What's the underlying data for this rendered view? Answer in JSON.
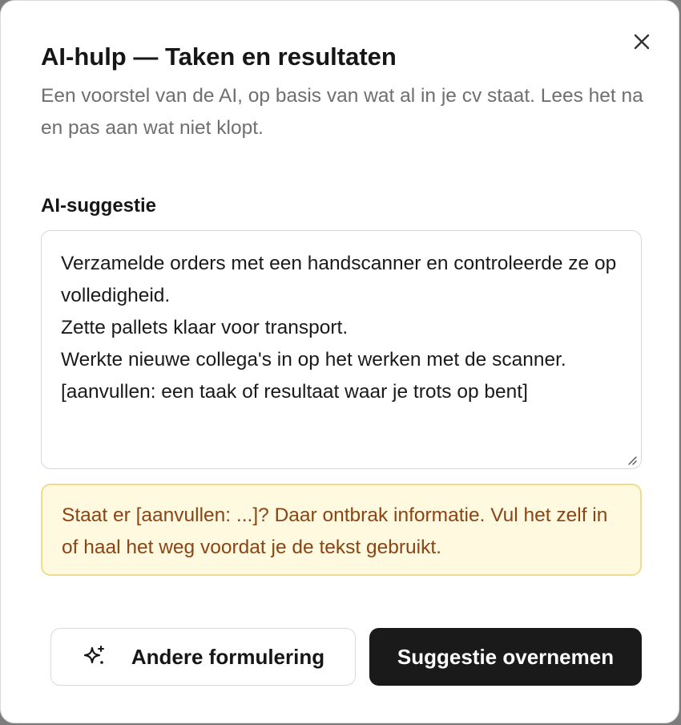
{
  "dialog": {
    "title": "AI-hulp — Taken en resultaten",
    "subtitle": "Een voorstel van de AI, op basis van wat al in je cv staat. Lees het na en pas aan wat niet klopt.",
    "close_icon": "close-icon"
  },
  "suggestion": {
    "label": "AI-suggestie",
    "value": "Verzamelde orders met een handscanner en controleerde ze op volledigheid.\nZette pallets klaar voor transport.\nWerkte nieuwe collega's in op het werken met de scanner.\n[aanvullen: een taak of resultaat waar je trots op bent]"
  },
  "notice": {
    "text": "Staat er [aanvullen: ...]? Daar ontbrak informatie. Vul het zelf in of haal het weg voordat je de tekst gebruikt."
  },
  "actions": {
    "rephrase_label": "Andere formulering",
    "rephrase_icon": "sparkle-icon",
    "accept_label": "Suggestie overnemen"
  },
  "colors": {
    "notice_bg": "#fff9e0",
    "notice_border": "#f1dc8e",
    "notice_text": "#8b4414",
    "primary_button": "#1a1a1a"
  }
}
